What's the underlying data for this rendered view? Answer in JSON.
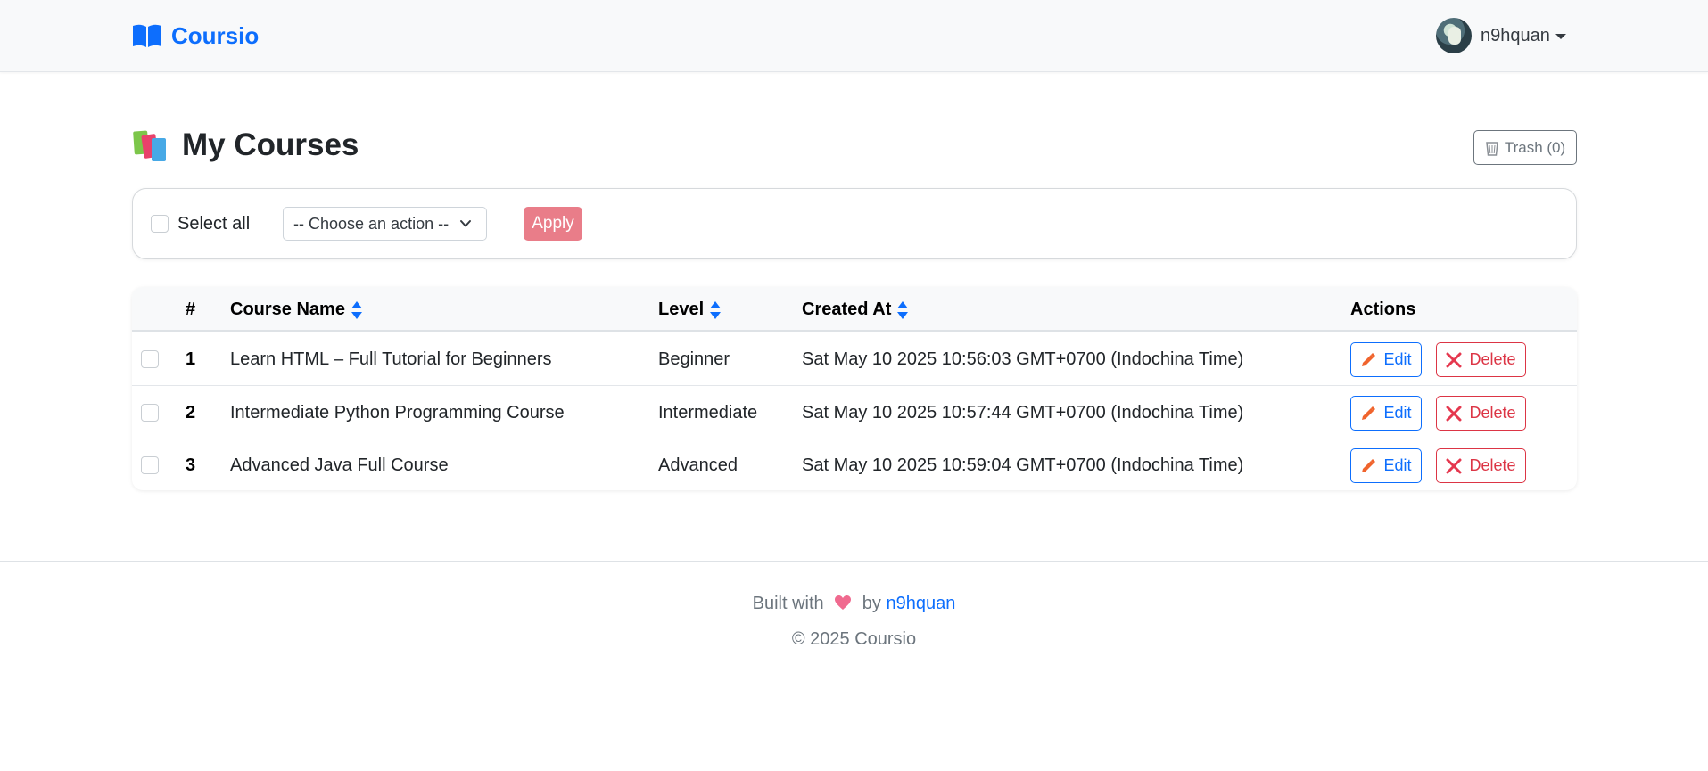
{
  "navbar": {
    "brand": "Coursio",
    "brand_icon": "open-book-icon",
    "username": "n9hquan"
  },
  "page": {
    "title": "My Courses",
    "title_icon": "books-icon",
    "trash_label": "Trash (0)"
  },
  "bulk": {
    "select_all_label": "Select all",
    "action_placeholder": "-- Choose an action --",
    "apply_label": "Apply"
  },
  "table": {
    "headers": {
      "index": "#",
      "course_name": "Course Name",
      "level": "Level",
      "created_at": "Created At",
      "actions": "Actions"
    },
    "rows": [
      {
        "index": "1",
        "name": "Learn HTML – Full Tutorial for Beginners",
        "level": "Beginner",
        "created_at": "Sat May 10 2025 10:56:03 GMT+0700 (Indochina Time)"
      },
      {
        "index": "2",
        "name": "Intermediate Python Programming Course",
        "level": "Intermediate",
        "created_at": "Sat May 10 2025 10:57:44 GMT+0700 (Indochina Time)"
      },
      {
        "index": "3",
        "name": "Advanced Java Full Course",
        "level": "Advanced",
        "created_at": "Sat May 10 2025 10:59:04 GMT+0700 (Indochina Time)"
      }
    ],
    "edit_label": "Edit",
    "delete_label": "Delete"
  },
  "footer": {
    "built_with": "Built with",
    "by": "by",
    "author": "n9hquan",
    "copyright": "© 2025 Coursio"
  },
  "colors": {
    "primary": "#0d6efd",
    "danger": "#dc3545",
    "apply_bg": "#e97d89",
    "navbar_bg": "#f8f9fa"
  }
}
